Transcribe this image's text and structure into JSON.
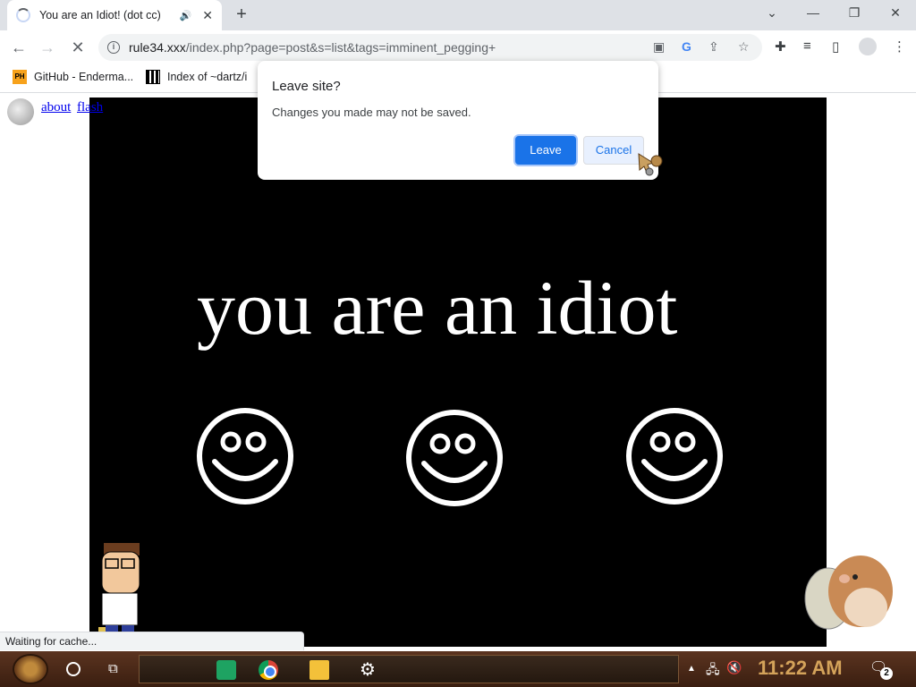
{
  "browser": {
    "tab": {
      "title": "You are an Idiot! (dot cc)",
      "audio_icon": "speaker-icon",
      "close": "✕"
    },
    "new_tab": "+",
    "window_controls": {
      "dropdown": "⌄",
      "minimize": "—",
      "restore": "❐",
      "close": "✕"
    },
    "nav": {
      "back": "←",
      "forward": "→",
      "stop": "✕"
    },
    "url": {
      "host": "rule34.xxx",
      "rest": "/index.php?page=post&s=list&tags=imminent_pegging+"
    },
    "bookmarks": [
      {
        "icon": "PH",
        "label": "GitHub - Enderma..."
      },
      {
        "icon": "qr",
        "label": "Index of ~dartz/i"
      }
    ]
  },
  "page": {
    "links": [
      "about",
      "flash"
    ],
    "headline": "you are an idiot",
    "smiley_count": 3,
    "status": "Waiting for cache..."
  },
  "dialog": {
    "title": "Leave site?",
    "message": "Changes you made may not be saved.",
    "leave_label": "Leave",
    "cancel_label": "Cancel"
  },
  "taskbar": {
    "clock": "11:22 AM",
    "notification_count": "2"
  },
  "colors": {
    "accent": "#1a73e8",
    "page_link": "#0000ee",
    "clock": "#d4a35a"
  }
}
